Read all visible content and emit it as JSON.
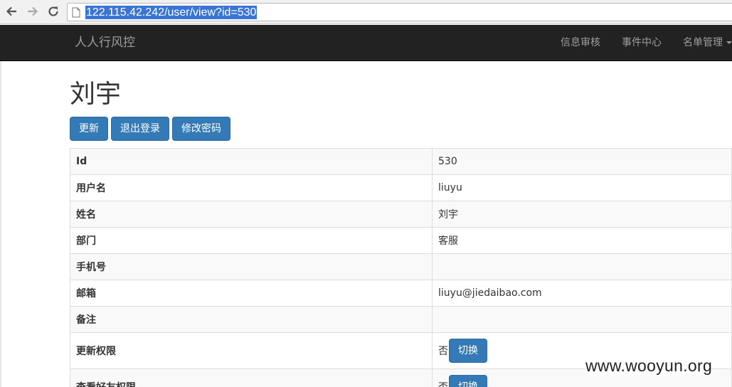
{
  "browser": {
    "url": "122.115.42.242/user/view?id=530",
    "back_icon": "arrow-left-icon",
    "forward_icon": "arrow-right-icon",
    "reload_icon": "reload-icon"
  },
  "navbar": {
    "brand": "人人行风控",
    "links": [
      "信息审核",
      "事件中心",
      "名单管理"
    ]
  },
  "page": {
    "title": "刘宇",
    "buttons": [
      "更新",
      "退出登录",
      "修改密码"
    ]
  },
  "details": {
    "rows": [
      {
        "label": "Id",
        "value": "530"
      },
      {
        "label": "用户名",
        "value": "liuyu"
      },
      {
        "label": "姓名",
        "value": "刘宇"
      },
      {
        "label": "部门",
        "value": "客服"
      },
      {
        "label": "手机号",
        "value": ""
      },
      {
        "label": "邮箱",
        "value": "liuyu@jiedaibao.com"
      },
      {
        "label": "备注",
        "value": ""
      }
    ],
    "permissions": [
      {
        "label": "更新权限",
        "value": "否",
        "toggle_label": "切换"
      },
      {
        "label": "查看好友权限",
        "value": "否",
        "toggle_label": "切换"
      }
    ]
  },
  "watermark": "www.wooyun.org",
  "colors": {
    "navbar_bg": "#222222",
    "primary_button": "#337ab7",
    "url_selection": "#3875d7"
  }
}
